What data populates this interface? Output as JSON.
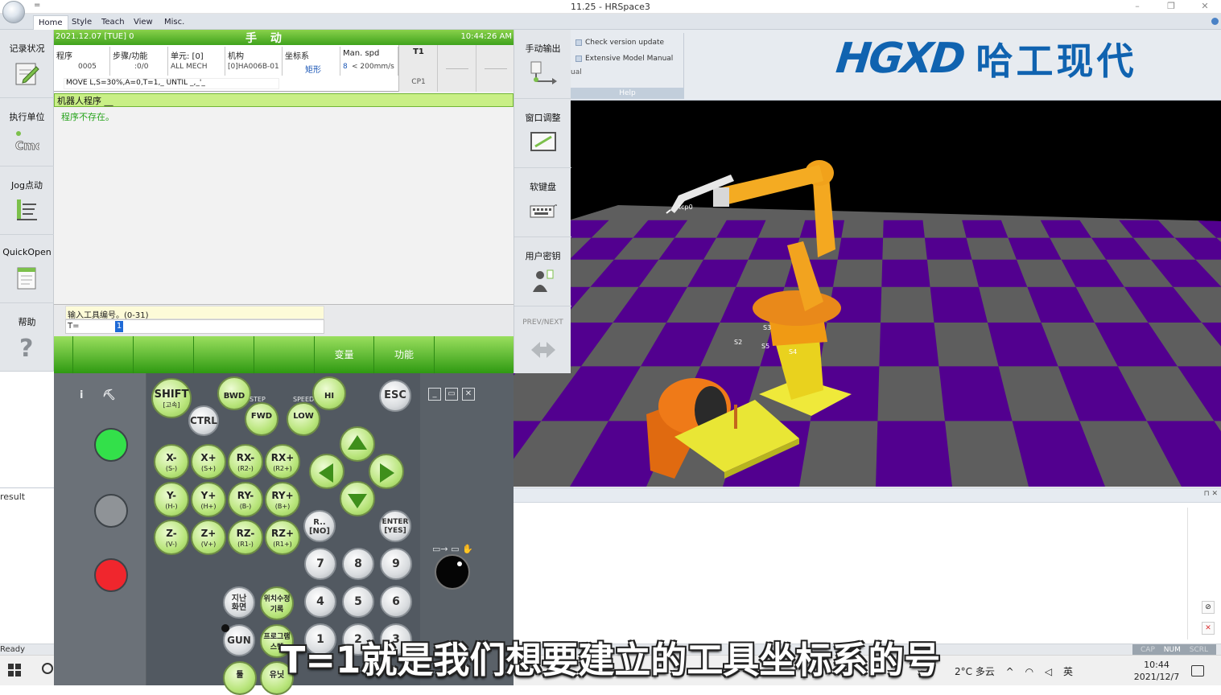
{
  "window": {
    "title": "11.25 - HRSpace3",
    "qat": "=",
    "controls": [
      "–",
      "❐",
      "✕"
    ]
  },
  "ribbon": {
    "tabs": [
      "Home",
      "Style",
      "Teach",
      "View",
      "Misc."
    ],
    "items": [
      "Check version update",
      "Extensive Model Manual"
    ],
    "stub_text": "ual",
    "group_label": "Help",
    "brand_latin": "HGXD",
    "brand_cn": "哈工现代"
  },
  "teach_pendant": {
    "left_buttons": [
      "记录状况",
      "执行单位",
      "Jog点动",
      "QuickOpen",
      "帮助"
    ],
    "right_buttons": [
      "手动输出",
      "窗口调整",
      "软键盘",
      "用户密钥",
      "PREV/NEXT"
    ],
    "top": {
      "date": "2021.12.07 [TUE]",
      "date_suffix": "0",
      "mode": "手 动",
      "time": "10:44:26 AM"
    },
    "info": [
      {
        "title": "程序",
        "value": "0005"
      },
      {
        "title": "步骤/功能",
        "value": ":0/0"
      },
      {
        "title": "单元: [0]",
        "value": "ALL MECH"
      },
      {
        "title": "机构",
        "value": "[0]HA006B-01"
      },
      {
        "title": "坐标系",
        "value": "矩形"
      },
      {
        "title": "Man. spd",
        "value": "< 200mm/s"
      }
    ],
    "speed_level": "8",
    "t1": {
      "top": "T1",
      "bottom": "CP1"
    },
    "command": "MOVE L,S=30%,A=0,T=1,_ UNTIL _,_'_",
    "program_header": "机器人程序 __",
    "program_message": "程序不存在。",
    "input": {
      "prompt": "输入工具编号。(0-31)",
      "label": "T=",
      "value": "1"
    },
    "fkeys": [
      "",
      "",
      "",
      "",
      "",
      "变量",
      "功能"
    ],
    "pendant_keys": {
      "shift": "SHIFT",
      "shift_sub": "[고속]",
      "ctrl": "CTRL",
      "esc": "ESC",
      "bwd": "BWD",
      "fwd": "FWD",
      "step": "STEP",
      "speed": "SPEED",
      "low": "LOW",
      "hi": "HI",
      "axis": [
        {
          "top": "X-",
          "sub": "(S-)"
        },
        {
          "top": "X+",
          "sub": "(S+)"
        },
        {
          "top": "RX-",
          "sub": "(R2-)"
        },
        {
          "top": "RX+",
          "sub": "(R2+)"
        },
        {
          "top": "Y-",
          "sub": "(H-)"
        },
        {
          "top": "Y+",
          "sub": "(H+)"
        },
        {
          "top": "RY-",
          "sub": "(B-)"
        },
        {
          "top": "RY+",
          "sub": "(B+)"
        },
        {
          "top": "Z-",
          "sub": "(V-)"
        },
        {
          "top": "Z+",
          "sub": "(V+)"
        },
        {
          "top": "RZ-",
          "sub": "(R1-)"
        },
        {
          "top": "RZ+",
          "sub": "(R1+)"
        }
      ],
      "r_no": "R..",
      "r_no_sub": "[NO]",
      "enter": "ENTER",
      "enter_sub": "[YES]",
      "digits": [
        "7",
        "8",
        "9",
        "4",
        "5",
        "6",
        "1",
        "2",
        "3"
      ],
      "korean1": "지난\n화면",
      "korean2": "위치수정\n기록",
      "gun": "GUN",
      "korean3": "프로그램\n스텝",
      "korean4": "툴",
      "korean5": "유닛"
    },
    "info_icons": [
      "i",
      "⛏"
    ],
    "win_controls": [
      "_",
      "▭",
      "✕"
    ],
    "lamps": {
      "green": "#33e04a",
      "gray": "#8f9397",
      "red": "#f0262d"
    }
  },
  "viewport": {
    "tcp_label": "tcp0",
    "joint_labels": [
      "S2",
      "S3",
      "S4",
      "S5"
    ]
  },
  "lower_panel": {
    "result_label": "result",
    "pin": "⊓ ✕"
  },
  "statusbar": {
    "ready": "Ready",
    "keys": [
      "CAP",
      "NUM",
      "SCRL"
    ]
  },
  "taskbar": {
    "weather": "2°C 多云",
    "ime": "英",
    "time": "10:44",
    "date": "2021/12/7"
  },
  "subtitle": "T=1就是我们想要建立的工具坐标系的号"
}
